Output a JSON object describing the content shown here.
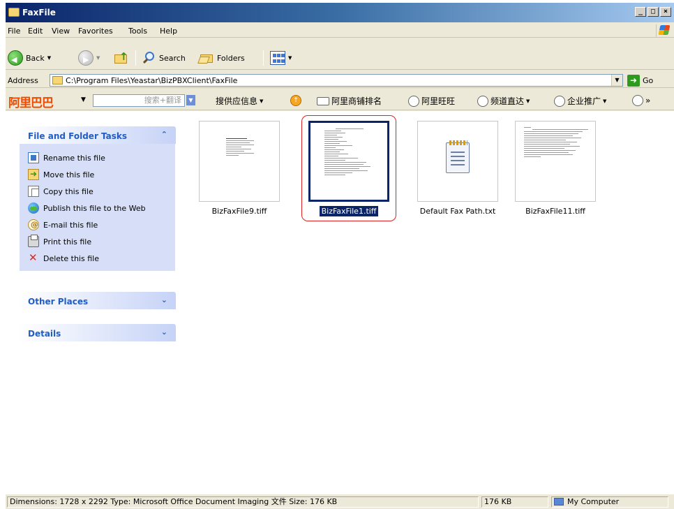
{
  "window": {
    "title": "FaxFile",
    "controls": [
      "_",
      "□",
      "×"
    ]
  },
  "menu": [
    "File",
    "Edit",
    "View",
    "Favorites",
    "Tools",
    "Help"
  ],
  "toolbar": {
    "back_label": "Back",
    "search_label": "Search",
    "folders_label": "Folders"
  },
  "address": {
    "label": "Address",
    "path": "C:\\Program Files\\Yeastar\\BizPBXClient\\FaxFile",
    "go_label": "Go"
  },
  "alibar": {
    "logo": "阿里巴巴",
    "search_placeholder": "搜索+翻译",
    "items": [
      "搜供应信息",
      "阿里商铺排名",
      "阿里旺旺",
      "频道直达",
      "企业推广"
    ],
    "overflow": "»"
  },
  "tasks": {
    "file_folder": {
      "title": "File and Folder Tasks",
      "items": [
        "Rename this file",
        "Move this file",
        "Copy this file",
        "Publish this file to the Web",
        "E-mail this file",
        "Print this file",
        "Delete this file"
      ]
    },
    "other_places": {
      "title": "Other Places"
    },
    "details": {
      "title": "Details"
    }
  },
  "files": [
    {
      "name": "BizFaxFile9.tiff",
      "type": "tiff"
    },
    {
      "name": "BizFaxFile1.tiff",
      "type": "tiff",
      "selected": true
    },
    {
      "name": "Default Fax Path.txt",
      "type": "txt"
    },
    {
      "name": "BizFaxFile11.tiff",
      "type": "tiff"
    }
  ],
  "status": {
    "details": "Dimensions: 1728 x 2292 Type: Microsoft Office Document Imaging 文件 Size: 176 KB",
    "size": "176 KB",
    "zone": "My Computer"
  },
  "colors": {
    "titlebar": "#0a246a",
    "selection": "#0a246a",
    "task_pane": "#d6dff7",
    "highlight_ring": "#e02020",
    "alibaba_orange": "#f04a00"
  }
}
